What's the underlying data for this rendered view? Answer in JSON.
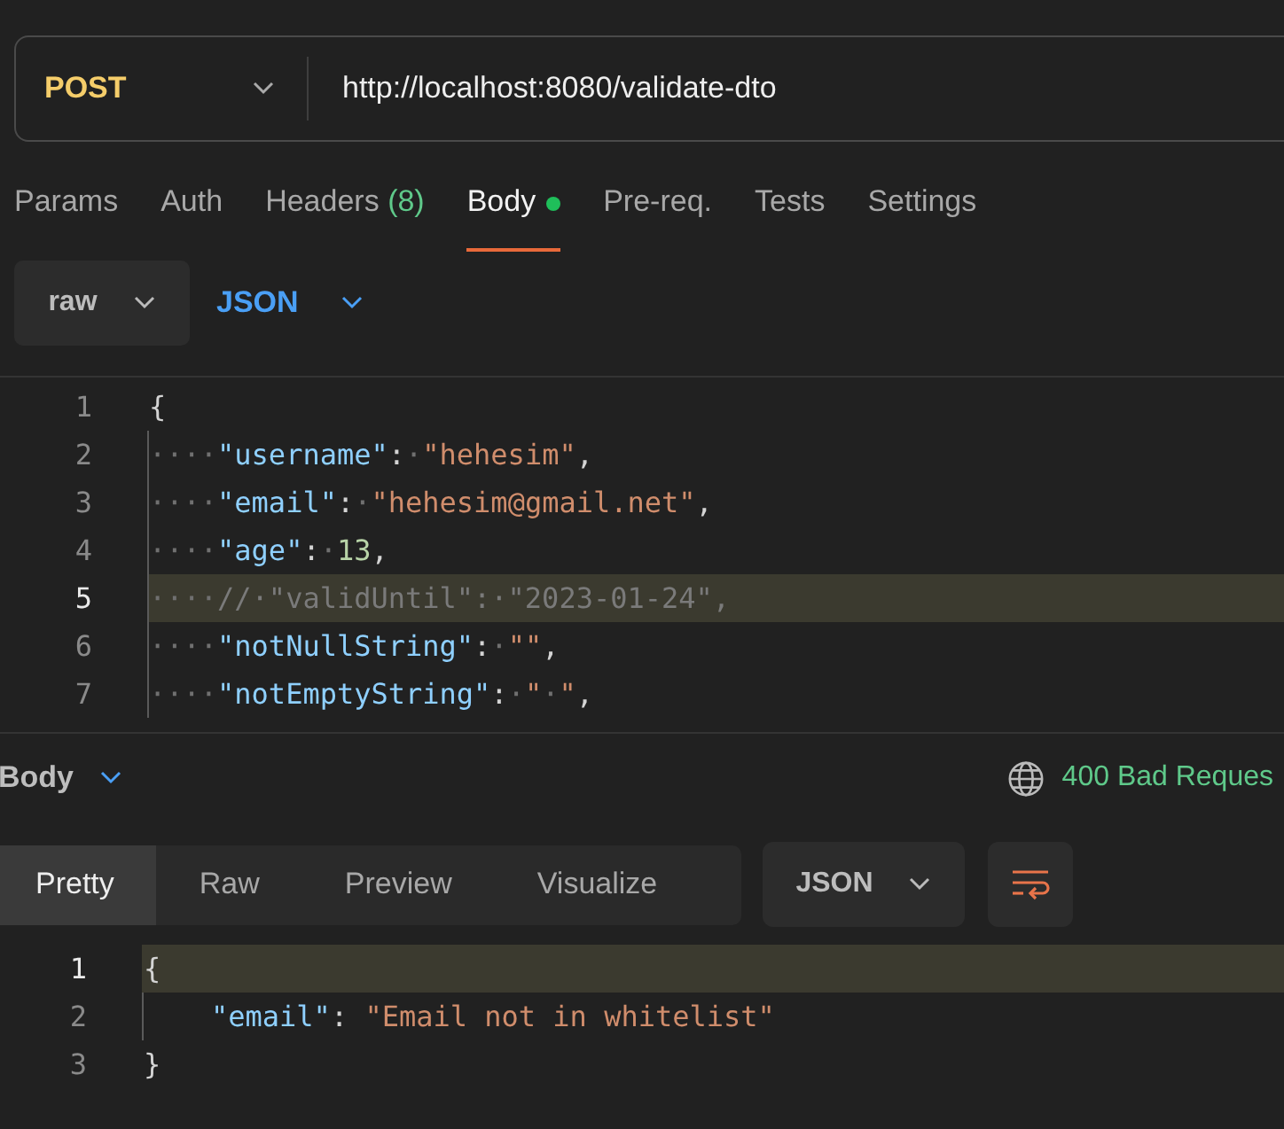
{
  "request": {
    "method": "POST",
    "url": "http://localhost:8080/validate-dto"
  },
  "tabs": [
    {
      "label": "Params",
      "selected": false
    },
    {
      "label": "Auth",
      "selected": false
    },
    {
      "label": "Headers",
      "count": "(8)",
      "selected": false
    },
    {
      "label": "Body",
      "selected": true,
      "dot": true
    },
    {
      "label": "Pre-req.",
      "selected": false
    },
    {
      "label": "Tests",
      "selected": false
    },
    {
      "label": "Settings",
      "selected": false
    }
  ],
  "body_mode": {
    "type": "raw",
    "language": "JSON"
  },
  "request_body": [
    {
      "number": "1",
      "highlighted": false,
      "guide": false,
      "tokens": [
        {
          "kind": "punct",
          "t": "{"
        }
      ]
    },
    {
      "number": "2",
      "highlighted": false,
      "guide": true,
      "tokens": [
        {
          "kind": "ws",
          "t": "····"
        },
        {
          "kind": "key",
          "t": "\"username\""
        },
        {
          "kind": "punct",
          "t": ":"
        },
        {
          "kind": "ws",
          "t": "·"
        },
        {
          "kind": "string",
          "t": "\"hehesim\""
        },
        {
          "kind": "punct",
          "t": ","
        }
      ]
    },
    {
      "number": "3",
      "highlighted": false,
      "guide": true,
      "tokens": [
        {
          "kind": "ws",
          "t": "····"
        },
        {
          "kind": "key",
          "t": "\"email\""
        },
        {
          "kind": "punct",
          "t": ":"
        },
        {
          "kind": "ws",
          "t": "·"
        },
        {
          "kind": "string",
          "t": "\"hehesim@gmail.net\""
        },
        {
          "kind": "punct",
          "t": ","
        }
      ]
    },
    {
      "number": "4",
      "highlighted": false,
      "guide": true,
      "tokens": [
        {
          "kind": "ws",
          "t": "····"
        },
        {
          "kind": "key",
          "t": "\"age\""
        },
        {
          "kind": "punct",
          "t": ":"
        },
        {
          "kind": "ws",
          "t": "·"
        },
        {
          "kind": "number",
          "t": "13"
        },
        {
          "kind": "punct",
          "t": ","
        }
      ]
    },
    {
      "number": "5",
      "highlighted": true,
      "guide": true,
      "tokens": [
        {
          "kind": "ws",
          "t": "····"
        },
        {
          "kind": "comment",
          "t": "//·\"validUntil\":·\"2023-01-24\","
        }
      ]
    },
    {
      "number": "6",
      "highlighted": false,
      "guide": true,
      "tokens": [
        {
          "kind": "ws",
          "t": "····"
        },
        {
          "kind": "key",
          "t": "\"notNullString\""
        },
        {
          "kind": "punct",
          "t": ":"
        },
        {
          "kind": "ws",
          "t": "·"
        },
        {
          "kind": "string",
          "t": "\"\""
        },
        {
          "kind": "punct",
          "t": ","
        }
      ]
    },
    {
      "number": "7",
      "highlighted": false,
      "guide": true,
      "tokens": [
        {
          "kind": "ws",
          "t": "····"
        },
        {
          "kind": "key",
          "t": "\"notEmptyString\""
        },
        {
          "kind": "punct",
          "t": ":"
        },
        {
          "kind": "ws",
          "t": "·"
        },
        {
          "kind": "string",
          "t": "\""
        },
        {
          "kind": "ws",
          "t": "·"
        },
        {
          "kind": "string",
          "t": "\""
        },
        {
          "kind": "punct",
          "t": ","
        }
      ]
    }
  ],
  "response": {
    "title": "Body",
    "status": "400 Bad Reques",
    "views": [
      {
        "label": "Pretty",
        "selected": true
      },
      {
        "label": "Raw",
        "selected": false
      },
      {
        "label": "Preview",
        "selected": false
      },
      {
        "label": "Visualize",
        "selected": false
      }
    ],
    "format": "JSON",
    "lines": [
      {
        "number": "1",
        "highlighted": true,
        "guide": false,
        "tokens": [
          {
            "kind": "punct",
            "t": "{"
          }
        ]
      },
      {
        "number": "2",
        "highlighted": false,
        "guide": true,
        "tokens": [
          {
            "kind": "key",
            "t": "\"email\""
          },
          {
            "kind": "punct",
            "t": ": "
          },
          {
            "kind": "string",
            "t": "\"Email not in whitelist\""
          }
        ]
      },
      {
        "number": "3",
        "highlighted": false,
        "guide": false,
        "tokens": [
          {
            "kind": "punct",
            "t": "}"
          }
        ]
      }
    ]
  }
}
